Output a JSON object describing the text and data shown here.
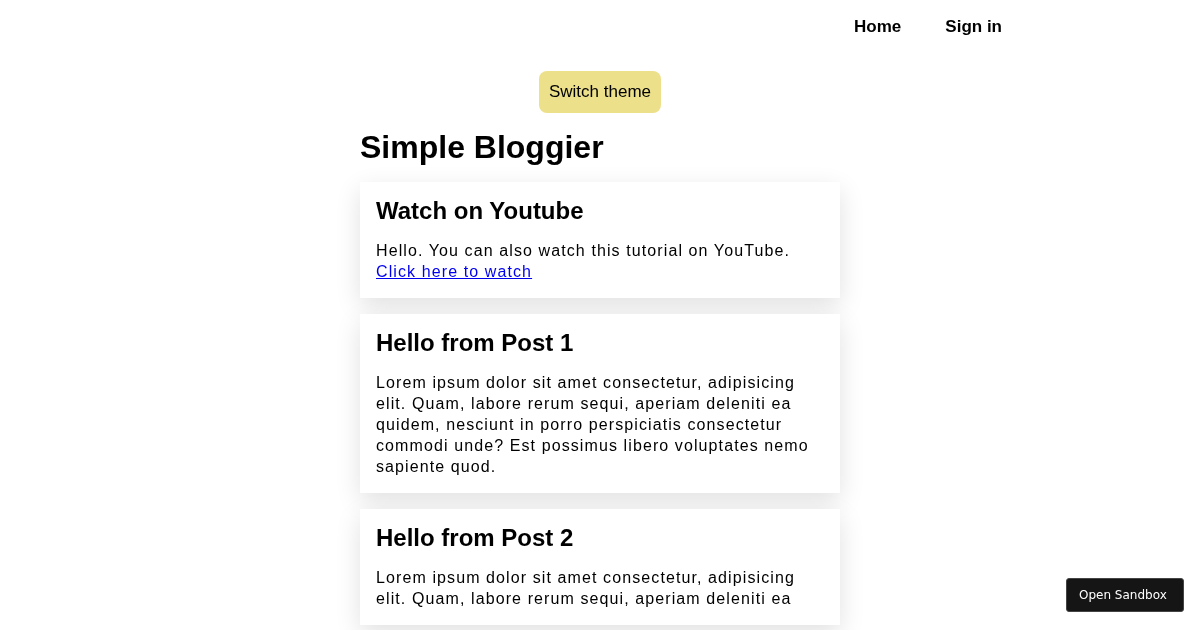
{
  "nav": {
    "links": [
      "Home",
      "Sign in"
    ]
  },
  "theme_button": "Switch theme",
  "title": "Simple Bloggier",
  "posts": [
    {
      "title": "Watch on Youtube",
      "body": "Hello. You can also watch this tutorial on YouTube.",
      "link": "Click here to watch"
    },
    {
      "title": "Hello from Post 1",
      "body": "Lorem ipsum dolor sit amet consectetur, adipisicing elit. Quam, labore rerum sequi, aperiam deleniti ea quidem, nesciunt in porro perspiciatis consectetur commodi unde? Est possimus libero voluptates nemo sapiente quod."
    },
    {
      "title": "Hello from Post 2",
      "body": "Lorem ipsum dolor sit amet consectetur, adipisicing elit. Quam, labore rerum sequi, aperiam deleniti ea"
    }
  ],
  "sandbox_button": "Open Sandbox"
}
